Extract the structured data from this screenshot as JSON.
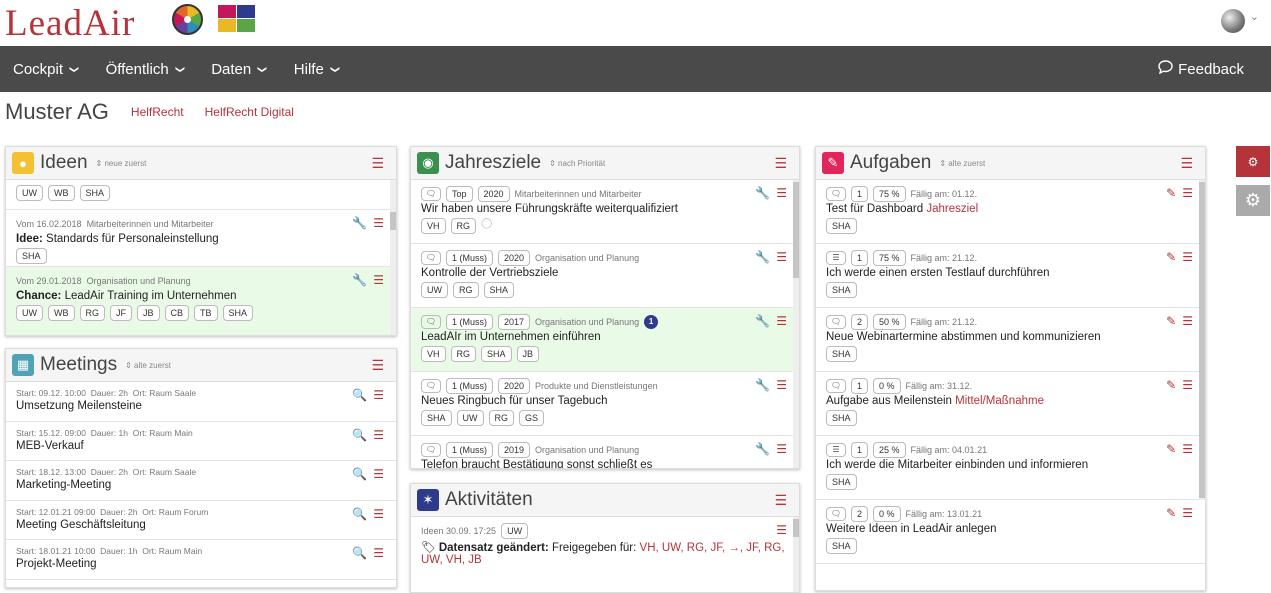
{
  "header": {
    "logo": "LeadAir",
    "nav": [
      "Cockpit",
      "Öffentlich",
      "Daten",
      "Hilfe"
    ],
    "feedback": "Feedback"
  },
  "subheader": {
    "company": "Muster AG",
    "links": [
      "HelfRecht",
      "HelfRecht Digital"
    ]
  },
  "colors": {
    "accent": "#b5343a",
    "nav_bg": "#4a4a4a",
    "highlight": "#e9fbe6"
  },
  "ideen": {
    "title": "Ideen",
    "sort": "neue zuerst",
    "top_tags": [
      "UW",
      "WB",
      "SHA"
    ],
    "items": [
      {
        "meta": "Vom 16.02.2018",
        "area": "Mitarbeiterinnen und Mitarbeiter",
        "kind": "Idee:",
        "text": "Standards für Personaleinstellung",
        "tags": [
          "SHA"
        ]
      },
      {
        "meta": "Vom 29.01.2018",
        "area": "Organisation und Planung",
        "kind": "Chance:",
        "text": "LeadAir Training im Unternehmen",
        "tags": [
          "UW",
          "WB",
          "RG",
          "JF",
          "JB",
          "CB",
          "TB",
          "SHA"
        ]
      }
    ]
  },
  "meetings": {
    "title": "Meetings",
    "sort": "alte zuerst",
    "items": [
      {
        "start": "Start: 09.12. 10:00",
        "dauer": "Dauer: 2h",
        "ort": "Ort: Raum Saale",
        "title": "Umsetzung Meilensteine"
      },
      {
        "start": "Start: 15.12. 09:00",
        "dauer": "Dauer: 1h",
        "ort": "Ort: Raum Main",
        "title": "MEB-Verkauf"
      },
      {
        "start": "Start: 18.12. 13:00",
        "dauer": "Dauer: 2h",
        "ort": "Ort: Raum Saale",
        "title": "Marketing-Meeting"
      },
      {
        "start": "Start: 12.01.21 09:00",
        "dauer": "Dauer: 2h",
        "ort": "Ort: Raum Forum",
        "title": "Meeting Geschäftsleitung"
      },
      {
        "start": "Start: 18.01.21 10:00",
        "dauer": "Dauer: 1h",
        "ort": "Ort: Raum Main",
        "title": "Projekt-Meeting"
      }
    ]
  },
  "jahresziele": {
    "title": "Jahresziele",
    "sort": "nach Priorität",
    "items": [
      {
        "prio": "Top",
        "year": "2020",
        "area": "Mitarbeiterinnen und Mitarbeiter",
        "text": "Wir haben unsere Führungskräfte weiterqualifiziert",
        "tags": [
          "VH",
          "RG"
        ],
        "badge": ""
      },
      {
        "prio": "1 (Muss)",
        "year": "2020",
        "area": "Organisation und Planung",
        "text": "Kontrolle der Vertriebsziele",
        "tags": [
          "UW",
          "RG",
          "SHA"
        ],
        "badge": ""
      },
      {
        "prio": "1 (Muss)",
        "year": "2017",
        "area": "Organisation und Planung",
        "text": "LeadAIr im Unternehmen einführen",
        "tags": [
          "VH",
          "RG",
          "SHA",
          "JB"
        ],
        "badge": "1"
      },
      {
        "prio": "1 (Muss)",
        "year": "2020",
        "area": "Produkte und Dienstleistungen",
        "text": "Neues Ringbuch für unser Tagebuch",
        "tags": [
          "SHA",
          "UW",
          "RG",
          "GS"
        ],
        "badge": ""
      },
      {
        "prio": "1 (Muss)",
        "year": "2019",
        "area": "Organisation und Planung",
        "text": "Telefon braucht Bestätigung sonst schließt es",
        "tags": [],
        "badge": ""
      }
    ]
  },
  "aktivitaeten": {
    "title": "Aktivitäten",
    "item": {
      "meta": "Ideen  30.09. 17:25",
      "tag": "UW",
      "label": "Datensatz geändert:",
      "text": "Freigegeben für:",
      "names": "VH, UW, RG, JF, →, JF, RG,",
      "names2": "UW, VH, JB"
    }
  },
  "aufgaben": {
    "title": "Aufgaben",
    "sort": "alte zuerst",
    "items": [
      {
        "num": "1",
        "pct": "75 %",
        "due": "Fällig am: 01.12.",
        "text": "Test für Dashboard ",
        "link": "Jahresziel",
        "tags": [
          "SHA"
        ],
        "icon": "bubble"
      },
      {
        "num": "1",
        "pct": "75 %",
        "due": "Fällig am: 21.12.",
        "text": "Ich werde einen ersten Testlauf durchführen",
        "link": "",
        "tags": [
          "SHA"
        ],
        "icon": "list"
      },
      {
        "num": "2",
        "pct": "50 %",
        "due": "Fällig am: 21.12.",
        "text": "Neue Webinartermine abstimmen und kommunizieren",
        "link": "",
        "tags": [
          "SHA"
        ],
        "icon": "bubble"
      },
      {
        "num": "1",
        "pct": "0 %",
        "due": "Fällig am: 31.12.",
        "text": "Aufgabe aus Meilenstein ",
        "link": "Mittel/Maßnahme",
        "tags": [
          "SHA"
        ],
        "icon": "bubble"
      },
      {
        "num": "1",
        "pct": "25 %",
        "due": "Fällig am: 04.01.21",
        "text": "Ich werde die Mitarbeiter einbinden und informieren",
        "link": "",
        "tags": [
          "SHA"
        ],
        "icon": "list"
      },
      {
        "num": "2",
        "pct": "0 %",
        "due": "Fällig am: 13.01.21",
        "text": "Weitere Ideen in LeadAir anlegen",
        "link": "",
        "tags": [
          "SHA"
        ],
        "icon": "bubble"
      }
    ]
  }
}
